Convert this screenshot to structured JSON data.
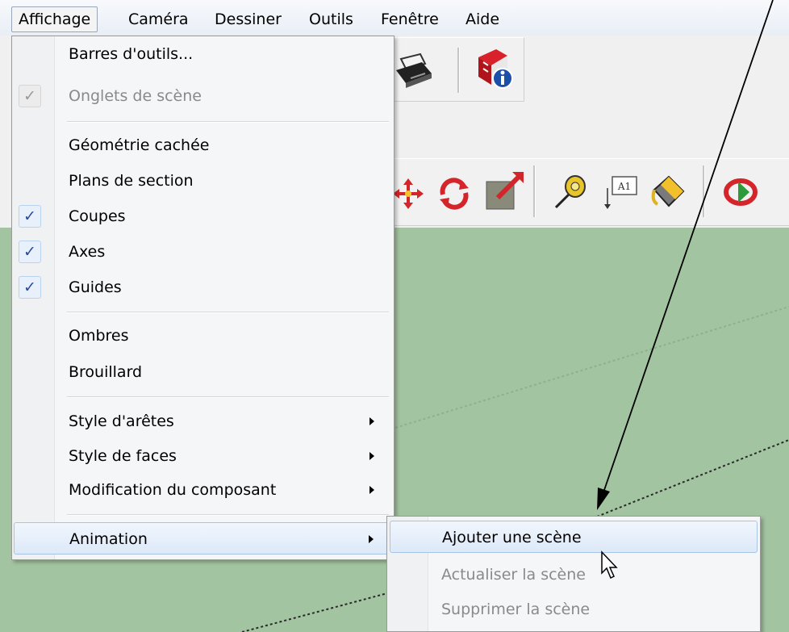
{
  "menubar": {
    "items": [
      {
        "label": "Affichage"
      },
      {
        "label": "Caméra"
      },
      {
        "label": "Dessiner"
      },
      {
        "label": "Outils"
      },
      {
        "label": "Fenêtre"
      },
      {
        "label": "Aide"
      }
    ]
  },
  "view_menu": {
    "items": [
      {
        "label": "Barres d'outils...",
        "checked": false,
        "disabled": false
      },
      {
        "label": "Onglets de scène",
        "checked": true,
        "disabled": true
      },
      {
        "label": "Géométrie cachée",
        "checked": false,
        "disabled": false
      },
      {
        "label": "Plans de section",
        "checked": false,
        "disabled": false
      },
      {
        "label": "Coupes",
        "checked": true,
        "disabled": false
      },
      {
        "label": "Axes",
        "checked": true,
        "disabled": false
      },
      {
        "label": "Guides",
        "checked": true,
        "disabled": false
      },
      {
        "label": "Ombres",
        "checked": false,
        "disabled": false
      },
      {
        "label": "Brouillard",
        "checked": false,
        "disabled": false
      },
      {
        "label": "Style d'arêtes",
        "submenu": true
      },
      {
        "label": "Style de faces",
        "submenu": true
      },
      {
        "label": "Modification du composant",
        "submenu": true
      },
      {
        "label": "Animation",
        "submenu": true,
        "highlighted": true
      }
    ],
    "check_glyph": "✓"
  },
  "animation_submenu": {
    "items": [
      {
        "label": "Ajouter une scène",
        "highlighted": true,
        "disabled": false
      },
      {
        "label": "Actualiser la scène",
        "disabled": true
      },
      {
        "label": "Supprimer la scène",
        "disabled": true
      }
    ]
  },
  "toolbar": {
    "label_tool_text": "A1"
  },
  "colors": {
    "viewport": "#a3c4a0",
    "highlight": "#dde9f8",
    "check": "#2b4a9a"
  }
}
